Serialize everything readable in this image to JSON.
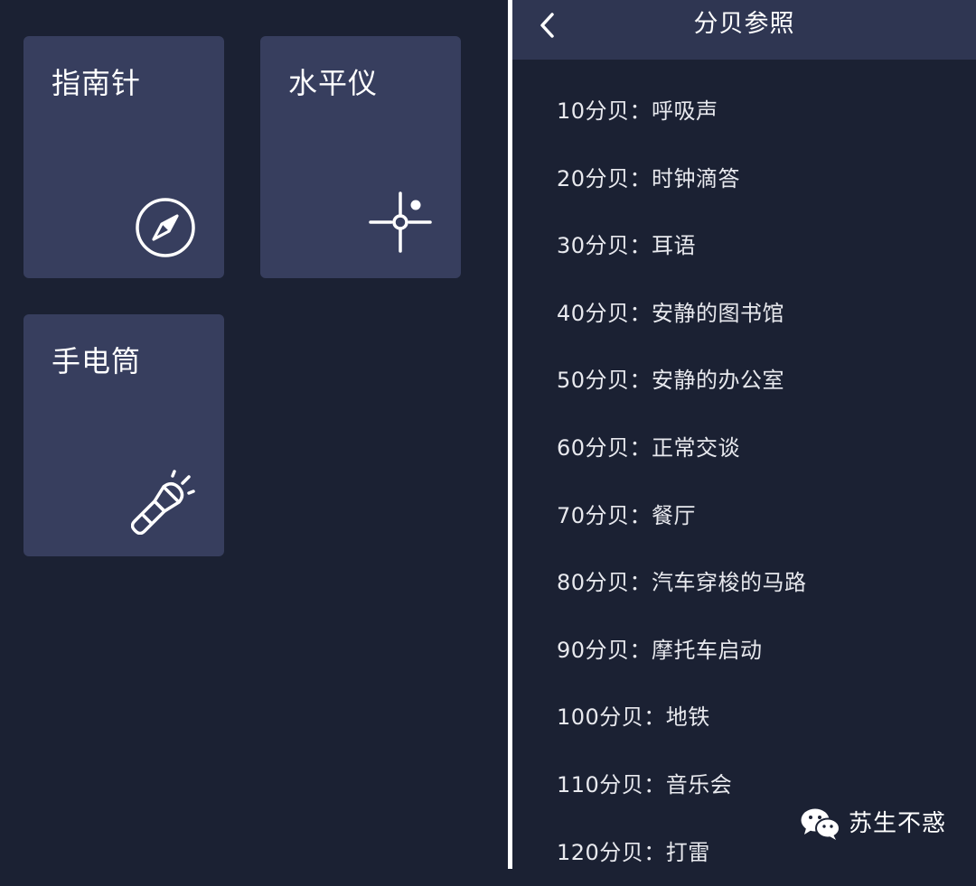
{
  "tools": [
    {
      "label": "指南针",
      "icon": "compass-icon"
    },
    {
      "label": "水平仪",
      "icon": "level-crosshair-icon"
    },
    {
      "label": "手电筒",
      "icon": "flashlight-icon"
    }
  ],
  "reference_screen": {
    "title": "分贝参照",
    "back_icon": "chevron-left-icon",
    "items": [
      "10分贝：呼吸声",
      "20分贝：时钟滴答",
      "30分贝：耳语",
      "40分贝：安静的图书馆",
      "50分贝：安静的办公室",
      "60分贝：正常交谈",
      "70分贝：餐厅",
      "80分贝：汽车穿梭的马路",
      "90分贝：摩托车启动",
      "100分贝：地铁",
      "110分贝：音乐会",
      "120分贝：打雷"
    ]
  },
  "watermark": {
    "text": "苏生不惑",
    "icon": "wechat-logo-icon"
  },
  "colors": {
    "background": "#1b2133",
    "tile": "#373e5e",
    "header": "#2f3652",
    "divider": "#ffffff",
    "text": "#ffffff"
  }
}
